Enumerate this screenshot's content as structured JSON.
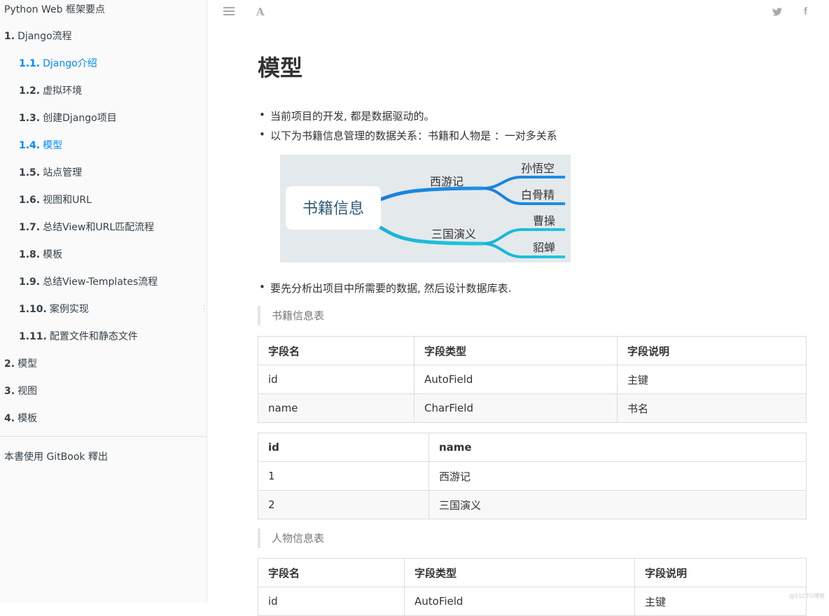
{
  "sidebar": {
    "book_title": "Python Web 框架要点",
    "items": [
      {
        "num": "1.",
        "label": "Django流程"
      },
      {
        "num": "1.1.",
        "label": "Django介绍"
      },
      {
        "num": "1.2.",
        "label": "虚拟环境"
      },
      {
        "num": "1.3.",
        "label": "创建Django项目"
      },
      {
        "num": "1.4.",
        "label": "模型"
      },
      {
        "num": "1.5.",
        "label": "站点管理"
      },
      {
        "num": "1.6.",
        "label": "视图和URL"
      },
      {
        "num": "1.7.",
        "label": "总结View和URL匹配流程"
      },
      {
        "num": "1.8.",
        "label": "模板"
      },
      {
        "num": "1.9.",
        "label": "总结View-Templates流程"
      },
      {
        "num": "1.10.",
        "label": "案例实现"
      },
      {
        "num": "1.11.",
        "label": "配置文件和静态文件"
      },
      {
        "num": "2.",
        "label": "模型"
      },
      {
        "num": "3.",
        "label": "视图"
      },
      {
        "num": "4.",
        "label": "模板"
      }
    ],
    "publish": "本書使用 GitBook 釋出",
    "active_color": "#008cff"
  },
  "header": {
    "menu_icon": "menu-icon",
    "font_icon": "A",
    "twitter_icon": "twitter-icon",
    "facebook_icon": "f"
  },
  "content": {
    "title": "模型",
    "bullets1": [
      "当前项目的开发, 都是数据驱动的。",
      "以下为书籍信息管理的数据关系：书籍和人物是 ：一对多关系"
    ],
    "mindmap": {
      "root": "书籍信息",
      "branches": [
        {
          "label": "西游记",
          "leaves": [
            "孙悟空",
            "白骨精"
          ]
        },
        {
          "label": "三国演义",
          "leaves": [
            "曹操",
            "貂蝉"
          ]
        }
      ]
    },
    "bullet2": "要先分析出项目中所需要的数据, 然后设计数据库表.",
    "quote1": "书籍信息表",
    "table1": {
      "headers": [
        "字段名",
        "字段类型",
        "字段说明"
      ],
      "rows": [
        [
          "id",
          "AutoField",
          "主键"
        ],
        [
          "name",
          "CharField",
          "书名"
        ]
      ]
    },
    "table2": {
      "headers": [
        "id",
        "name"
      ],
      "rows": [
        [
          "1",
          "西游记"
        ],
        [
          "2",
          "三国演义"
        ]
      ]
    },
    "quote2": "人物信息表",
    "table3": {
      "headers": [
        "字段名",
        "字段类型",
        "字段说明"
      ],
      "rows": [
        [
          "id",
          "AutoField",
          "主键"
        ]
      ]
    }
  },
  "watermark": "@51CTO博客"
}
